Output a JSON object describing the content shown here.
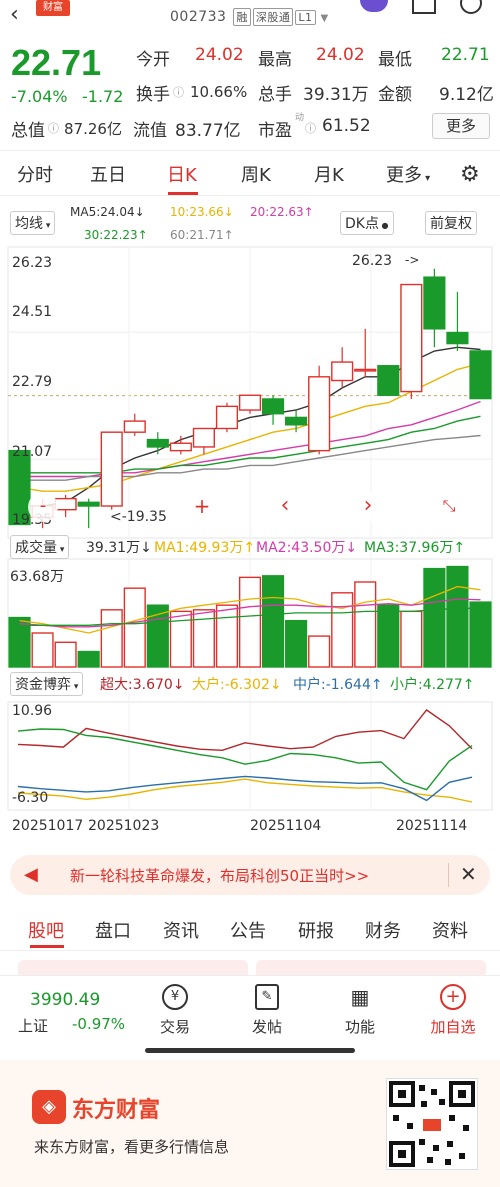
{
  "header": {
    "badge": "财富",
    "stock_code": "002733",
    "tags": [
      "融",
      "深股通",
      "L1"
    ]
  },
  "quote": {
    "price": "22.71",
    "change_pct": "-7.04%",
    "change": "-1.72",
    "open_label": "今开",
    "open": "24.02",
    "high_label": "最高",
    "high": "24.02",
    "low_label": "最低",
    "low": "22.71",
    "turnover_label": "换手",
    "turnover": "10.66%",
    "volume_label": "总手",
    "volume": "39.31万",
    "amount_label": "金额",
    "amount": "9.12亿",
    "mcap_label": "总值",
    "mcap": "87.26亿",
    "float_label": "流值",
    "float_mcap": "83.77亿",
    "pe_label": "市盈",
    "pe_sup": "动",
    "pe": "61.52",
    "more_label": "更多"
  },
  "tabs": [
    "分时",
    "五日",
    "日K",
    "周K",
    "月K",
    "更多"
  ],
  "ma_legend": {
    "selector": "均线",
    "ma5": "MA5:24.04↓",
    "ma10": "10:23.66↓",
    "ma20": "20:22.63↑",
    "ma30": "30:22.23↑",
    "ma60": "60:21.71↑",
    "dk": "DK点",
    "adjust": "前复权"
  },
  "colors": {
    "up": "#e0302b",
    "down": "#1a9a2a",
    "ma5": "#333333",
    "ma10": "#e8b400",
    "ma20": "#d63aa8",
    "ma30": "#1a9a2a",
    "ma60": "#888888"
  },
  "chart_data": {
    "type": "candlestick",
    "price_axis_labels": [
      "26.23",
      "24.51",
      "22.79",
      "21.07",
      "19.35"
    ],
    "annotations": {
      "high_marker": "26.23",
      "low_marker": "<-19.35"
    },
    "candles": [
      {
        "o": 21.3,
        "c": 19.3,
        "h": 21.3,
        "l": 19.3
      },
      {
        "o": 19.5,
        "c": 19.8,
        "h": 20.0,
        "l": 19.2
      },
      {
        "o": 19.7,
        "c": 20.0,
        "h": 20.1,
        "l": 19.5
      },
      {
        "o": 19.9,
        "c": 19.8,
        "h": 20.0,
        "l": 19.2
      },
      {
        "o": 19.8,
        "c": 21.8,
        "h": 21.8,
        "l": 19.7
      },
      {
        "o": 21.8,
        "c": 22.1,
        "h": 22.3,
        "l": 21.7
      },
      {
        "o": 21.6,
        "c": 21.4,
        "h": 21.8,
        "l": 21.2
      },
      {
        "o": 21.3,
        "c": 21.5,
        "h": 21.7,
        "l": 21.2
      },
      {
        "o": 21.4,
        "c": 21.9,
        "h": 21.9,
        "l": 21.2
      },
      {
        "o": 21.9,
        "c": 22.5,
        "h": 22.6,
        "l": 21.8
      },
      {
        "o": 22.4,
        "c": 22.8,
        "h": 22.8,
        "l": 22.3
      },
      {
        "o": 22.7,
        "c": 22.3,
        "h": 22.8,
        "l": 22.0
      },
      {
        "o": 22.2,
        "c": 22.0,
        "h": 22.4,
        "l": 21.8
      },
      {
        "o": 21.3,
        "c": 23.3,
        "h": 23.6,
        "l": 21.2
      },
      {
        "o": 23.2,
        "c": 23.7,
        "h": 24.1,
        "l": 23.0
      },
      {
        "o": 23.5,
        "c": 23.5,
        "h": 24.6,
        "l": 23.3
      },
      {
        "o": 23.6,
        "c": 22.8,
        "h": 23.6,
        "l": 22.8
      },
      {
        "o": 22.9,
        "c": 25.8,
        "h": 25.8,
        "l": 22.7
      },
      {
        "o": 26.0,
        "c": 24.6,
        "h": 26.23,
        "l": 24.1
      },
      {
        "o": 24.5,
        "c": 24.2,
        "h": 25.6,
        "l": 24.0
      },
      {
        "o": 24.0,
        "c": 22.71,
        "h": 24.02,
        "l": 22.71
      }
    ],
    "ma_lines": {
      "ma5": [
        19.8,
        19.8,
        19.9,
        20.3,
        20.8,
        21.1,
        21.3,
        21.6,
        21.8,
        22.0,
        22.2,
        22.3,
        22.4,
        22.6,
        23.0,
        23.3,
        23.3,
        23.7,
        24.0,
        24.1,
        24.04
      ],
      "ma10": [
        20.3,
        20.2,
        20.2,
        20.3,
        20.4,
        20.6,
        20.8,
        21.0,
        21.2,
        21.4,
        21.6,
        21.8,
        21.9,
        22.1,
        22.3,
        22.5,
        22.6,
        22.9,
        23.2,
        23.5,
        23.66
      ],
      "ma20": [
        20.6,
        20.6,
        20.6,
        20.6,
        20.7,
        20.7,
        20.8,
        20.9,
        21.0,
        21.1,
        21.2,
        21.3,
        21.4,
        21.5,
        21.6,
        21.7,
        21.9,
        22.0,
        22.2,
        22.4,
        22.63
      ],
      "ma30": [
        20.7,
        20.7,
        20.7,
        20.7,
        20.7,
        20.8,
        20.8,
        20.9,
        20.9,
        21.0,
        21.1,
        21.1,
        21.2,
        21.3,
        21.4,
        21.5,
        21.6,
        21.8,
        21.9,
        22.1,
        22.23
      ],
      "ma60": [
        20.5,
        20.5,
        20.5,
        20.6,
        20.6,
        20.6,
        20.7,
        20.7,
        20.8,
        20.8,
        20.9,
        20.9,
        21.0,
        21.1,
        21.2,
        21.3,
        21.4,
        21.5,
        21.6,
        21.65,
        21.71
      ]
    },
    "volume": {
      "label": "成交量",
      "value": "39.31万↓",
      "ma1": "MA1:49.93万↑",
      "ma2": "MA2:43.50万↓",
      "ma3": "MA3:37.96万↑",
      "axis_label": "63.68万",
      "bars": [
        32,
        22,
        16,
        10,
        37,
        51,
        40,
        36,
        37,
        40,
        58,
        59,
        30,
        20,
        48,
        55,
        40,
        36,
        63.68,
        65,
        42
      ],
      "ma1_line": [
        30,
        28,
        25,
        22,
        26,
        30,
        34,
        38,
        40,
        42,
        44,
        45,
        44,
        40,
        38,
        42,
        44,
        40,
        46,
        52,
        49.93
      ],
      "ma2_line": [
        28,
        27,
        26,
        26,
        27,
        29,
        31,
        33,
        35,
        37,
        39,
        40,
        40,
        39,
        39,
        40,
        41,
        40,
        42,
        44,
        43.5
      ],
      "ma3_line": [
        27,
        27,
        27,
        27,
        28,
        28,
        29,
        30,
        31,
        32,
        33,
        34,
        35,
        35,
        35,
        36,
        36,
        36,
        37,
        38,
        37.96
      ]
    },
    "capital_flow": {
      "label": "资金博弈",
      "super": "超大:3.670↓",
      "large": "大户:-6.302↓",
      "medium": "中户:-1.644↑",
      "small": "小户:4.277↑",
      "axis_max": "10.96",
      "axis_min": "-6.30",
      "super_line": [
        4.5,
        4.3,
        4.0,
        7.5,
        6.6,
        5.8,
        5.0,
        4.2,
        3.6,
        3.4,
        4.8,
        4.2,
        3.7,
        4.0,
        6.0,
        6.8,
        7.1,
        5.6,
        10.96,
        8.0,
        3.67
      ],
      "large_line": [
        -4.6,
        -4.9,
        -5.2,
        -5.8,
        -5.4,
        -4.8,
        -4.0,
        -3.4,
        -3.0,
        -2.6,
        -2.0,
        -2.7,
        -3.0,
        -3.3,
        -3.5,
        -3.7,
        -3.6,
        -4.4,
        -5.0,
        -5.4,
        -6.302
      ],
      "medium_line": [
        -3.4,
        -3.8,
        -4.1,
        -4.4,
        -4.2,
        -3.6,
        -3.1,
        -2.7,
        -2.3,
        -1.9,
        -1.5,
        -1.8,
        -2.2,
        -2.5,
        -2.6,
        -2.8,
        -2.7,
        -3.8,
        -6.0,
        -2.6,
        -1.644
      ],
      "small_line": [
        7.0,
        7.4,
        7.3,
        6.2,
        5.8,
        5.0,
        4.2,
        3.4,
        2.6,
        2.0,
        0.8,
        1.5,
        2.8,
        2.6,
        2.0,
        1.0,
        1.2,
        -2.6,
        -4.0,
        1.4,
        4.277
      ]
    },
    "x_labels": [
      "20251017",
      "20251023",
      "20251104",
      "20251114"
    ],
    "lower_ylabel": "",
    "xlabel": ""
  },
  "chart_controls": [
    "-",
    "+",
    "‹",
    "›",
    "⤡"
  ],
  "banner": {
    "text": "新一轮科技革命爆发，布局科创50正当时>>"
  },
  "bottom_tabs": [
    "股吧",
    "盘口",
    "资讯",
    "公告",
    "研报",
    "财务",
    "资料"
  ],
  "bottom_nav": {
    "index_value": "3990.49",
    "index_name": "上证",
    "index_change": "-0.97%",
    "items": [
      "交易",
      "发帖",
      "功能",
      "加自选"
    ]
  },
  "promo": {
    "brand": "东方财富",
    "slogan": "来东方财富，看更多行情信息"
  }
}
